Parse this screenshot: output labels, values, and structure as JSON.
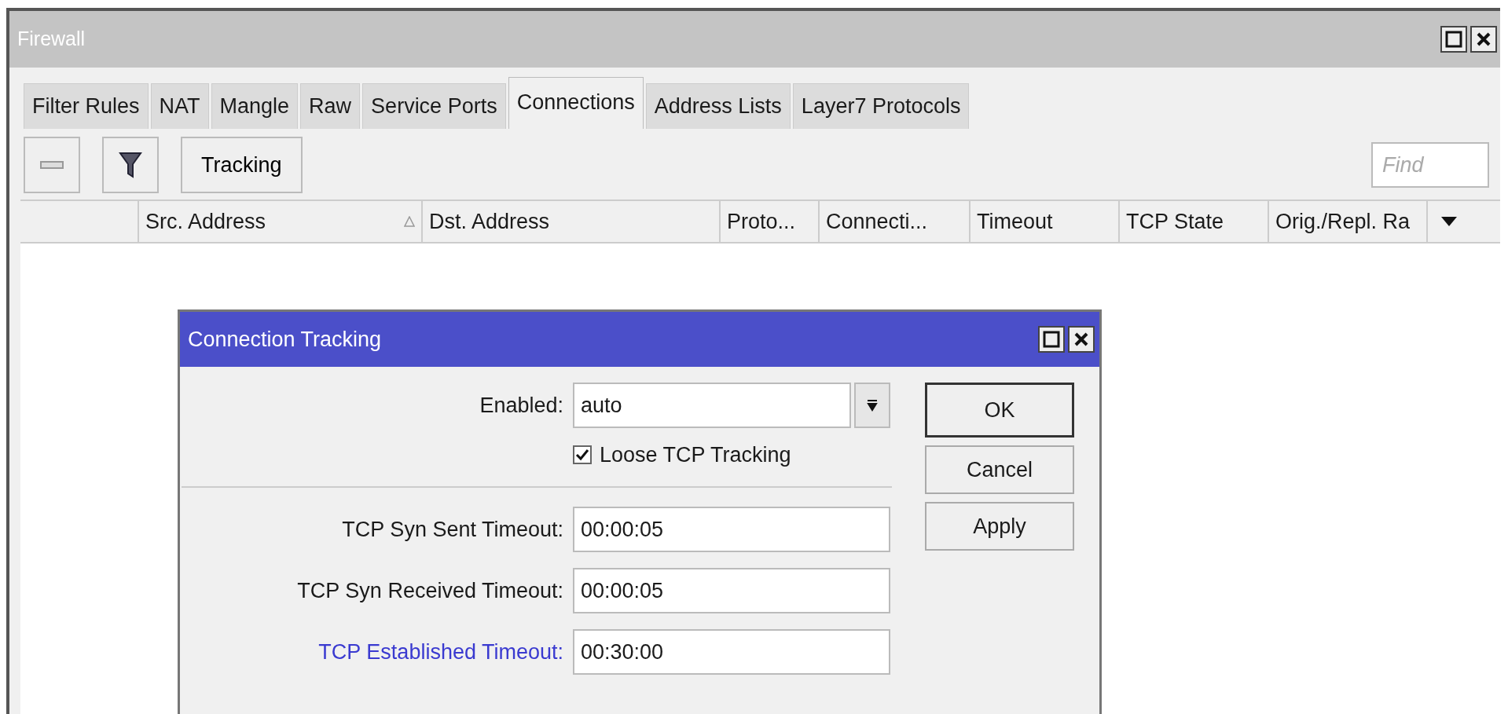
{
  "window": {
    "title": "Firewall"
  },
  "tabs": [
    {
      "label": "Filter Rules",
      "selected": false
    },
    {
      "label": "NAT",
      "selected": false
    },
    {
      "label": "Mangle",
      "selected": false
    },
    {
      "label": "Raw",
      "selected": false
    },
    {
      "label": "Service Ports",
      "selected": false
    },
    {
      "label": "Connections",
      "selected": true
    },
    {
      "label": "Address Lists",
      "selected": false
    },
    {
      "label": "Layer7 Protocols",
      "selected": false
    }
  ],
  "toolbar": {
    "tracking_button": "Tracking"
  },
  "search": {
    "placeholder": "Find"
  },
  "table": {
    "columns": [
      {
        "label": "Src. Address",
        "sorted": true
      },
      {
        "label": "Dst. Address",
        "sorted": false
      },
      {
        "label": "Proto...",
        "sorted": false
      },
      {
        "label": "Connecti...",
        "sorted": false
      },
      {
        "label": "Timeout",
        "sorted": false
      },
      {
        "label": "TCP State",
        "sorted": false
      },
      {
        "label": "Orig./Repl. Ra",
        "sorted": false
      }
    ]
  },
  "dialog": {
    "title": "Connection Tracking",
    "fields": [
      {
        "kind": "select",
        "label": "Enabled:",
        "value": "auto",
        "highlighted": false
      },
      {
        "kind": "checkbox",
        "label": "Loose TCP Tracking",
        "checked": true
      },
      {
        "kind": "separator"
      },
      {
        "kind": "text",
        "label": "TCP Syn Sent Timeout:",
        "value": "00:00:05",
        "highlighted": false
      },
      {
        "kind": "text",
        "label": "TCP Syn Received Timeout:",
        "value": "00:00:05",
        "highlighted": false
      },
      {
        "kind": "text",
        "label": "TCP Established Timeout:",
        "value": "00:30:00",
        "highlighted": true
      }
    ],
    "buttons": [
      {
        "label": "OK",
        "default": true
      },
      {
        "label": "Cancel",
        "default": false
      },
      {
        "label": "Apply",
        "default": false
      }
    ]
  }
}
